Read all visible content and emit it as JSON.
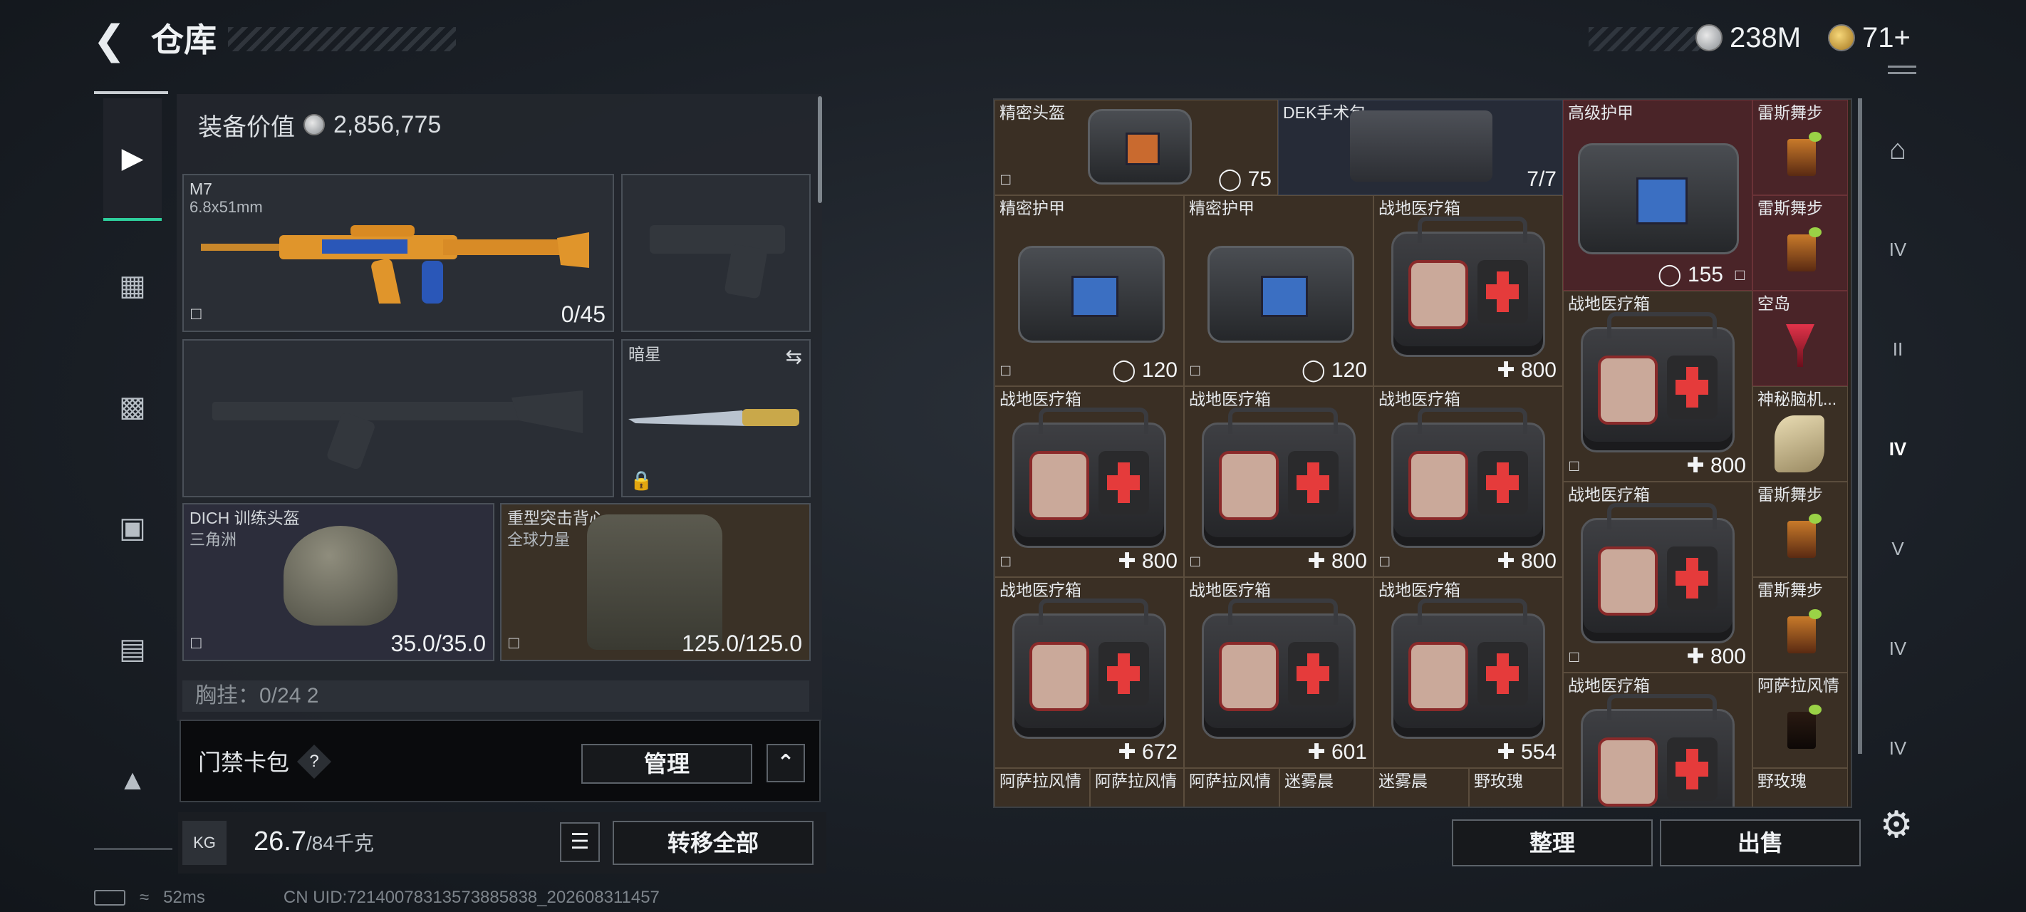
{
  "header": {
    "title": "仓库"
  },
  "currency": {
    "silver": "238M",
    "gold": "71+"
  },
  "equipment": {
    "value_label": "装备价值",
    "value": "2,856,775",
    "primary": {
      "name": "M7",
      "caliber": "6.8x51mm",
      "ammo": "0/45"
    },
    "melee": {
      "name": "暗星"
    },
    "helmet": {
      "name": "DICH 训练头盔",
      "sub": "三角洲",
      "durability": "35.0/35.0"
    },
    "armor": {
      "name": "重型突击背心",
      "sub": "全球力量",
      "durability": "125.0/125.0"
    },
    "chest_partial": "胸挂：0/24 2"
  },
  "card_bar": {
    "label": "门禁卡包",
    "help": "?",
    "manage": "管理"
  },
  "weight": {
    "current": "26.7",
    "max": "/84千克",
    "kg": "KG",
    "transfer_all": "转移全部"
  },
  "status": {
    "ping": "52ms",
    "uid": "CN UID:72140078313573885838_202608311457"
  },
  "stash": {
    "items": [
      {
        "name": "精密头盔",
        "count": "75",
        "count_icon": "shield"
      },
      {
        "name": "DEK手术包",
        "count": "7/7"
      },
      {
        "name": "高级护甲",
        "count": "155",
        "count_icon": "shield"
      },
      {
        "name": "雷斯舞步"
      },
      {
        "name": "雷斯舞步"
      },
      {
        "name": "精密护甲",
        "count": "120",
        "count_icon": "shield"
      },
      {
        "name": "精密护甲",
        "count": "120",
        "count_icon": "shield"
      },
      {
        "name": "战地医疗箱",
        "count": "800",
        "count_icon": "plus"
      },
      {
        "name": "战地医疗箱",
        "count": "800",
        "count_icon": "plus"
      },
      {
        "name": "空岛"
      },
      {
        "name": "战地医疗箱",
        "count": "800",
        "count_icon": "plus"
      },
      {
        "name": "战地医疗箱",
        "count": "800",
        "count_icon": "plus"
      },
      {
        "name": "战地医疗箱",
        "count": "800",
        "count_icon": "plus"
      },
      {
        "name": "神秘脑机..."
      },
      {
        "name": "战地医疗箱",
        "count": "800",
        "count_icon": "plus"
      },
      {
        "name": "雷斯舞步"
      },
      {
        "name": "雷斯舞步"
      },
      {
        "name": "战地医疗箱",
        "count": "672",
        "count_icon": "plus"
      },
      {
        "name": "战地医疗箱",
        "count": "601",
        "count_icon": "plus"
      },
      {
        "name": "战地医疗箱",
        "count": "554",
        "count_icon": "plus"
      },
      {
        "name": "战地医疗箱"
      },
      {
        "name": "阿萨拉风情"
      },
      {
        "name": "阿萨拉风情"
      },
      {
        "name": "阿萨拉风情"
      },
      {
        "name": "阿萨拉风情"
      },
      {
        "name": "迷雾晨"
      },
      {
        "name": "迷雾晨"
      },
      {
        "name": "野玫瑰"
      },
      {
        "name": "野玫瑰"
      }
    ],
    "sort_label": "整理",
    "sell_label": "出售"
  },
  "right_toolbar": [
    "IV",
    "II",
    "IV",
    "V",
    "IV",
    "IV"
  ],
  "colors": {
    "accent_green": "#2ecf9c",
    "stash_bg": "#3a2f24",
    "blue_cell": "#262b37",
    "red_cell": "#4a2428"
  }
}
